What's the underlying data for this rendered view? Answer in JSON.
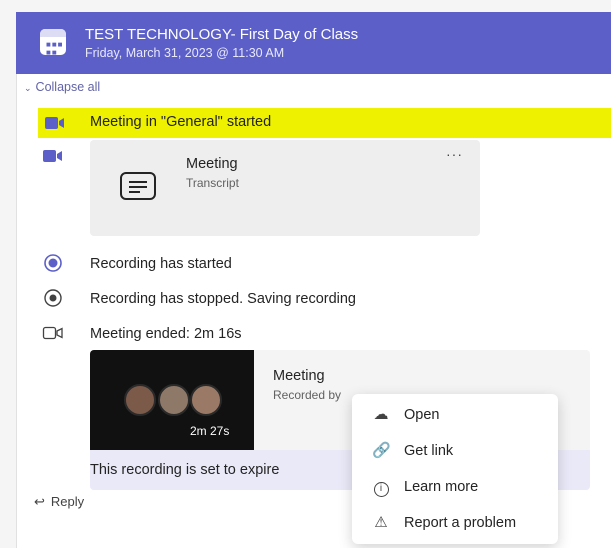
{
  "header": {
    "title": "TEST TECHNOLOGY- First Day of Class",
    "subtitle": "Friday, March 31, 2023 @ 11:30 AM",
    "accent": "#5b5fc7"
  },
  "collapse_all": "Collapse all",
  "events": {
    "meeting_started": "Meeting in \"General\" started",
    "recording_started": "Recording has started",
    "recording_stopped": "Recording has stopped. Saving recording",
    "meeting_ended": "Meeting ended: 2m 16s"
  },
  "transcript_card": {
    "title": "Meeting",
    "subtitle": "Transcript"
  },
  "recording_card": {
    "title": "Meeting",
    "subtitle": "Recorded by",
    "duration": "2m 27s",
    "expiry_notice": "This recording is set to expire"
  },
  "reply": "Reply",
  "context_menu": {
    "items": [
      {
        "label": "Open",
        "icon": "cloud-icon"
      },
      {
        "label": "Get link",
        "icon": "link-icon"
      },
      {
        "label": "Learn more",
        "icon": "info-icon"
      },
      {
        "label": "Report a problem",
        "icon": "warning-icon"
      }
    ]
  },
  "colors": {
    "highlight": "#eef200",
    "accent": "#5b5fc7",
    "selected_bar": "#6264a7"
  }
}
